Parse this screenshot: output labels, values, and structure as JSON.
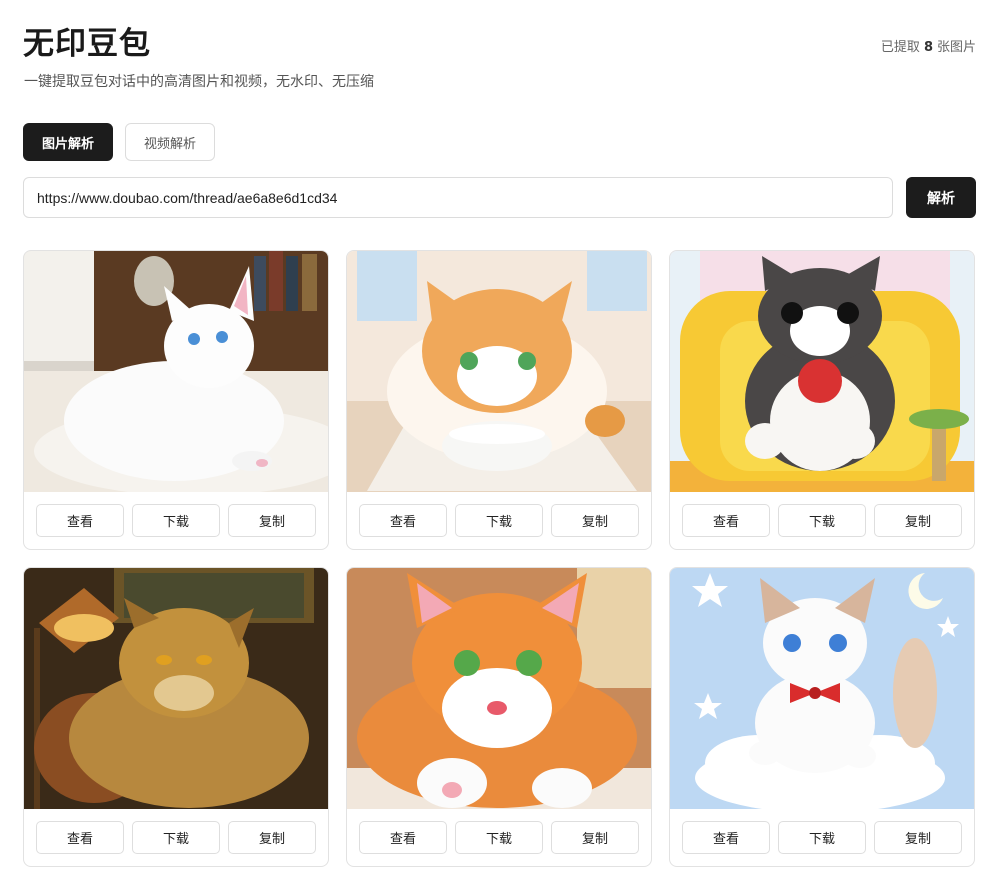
{
  "app": {
    "title": "无印豆包",
    "subtitle": "一键提取豆包对话中的高清图片和视频，无水印、无压缩",
    "count": {
      "prefix": "已提取",
      "value": "8",
      "suffix": "张图片"
    }
  },
  "tabs": [
    {
      "label": "图片解析",
      "active": true
    },
    {
      "label": "视频解析",
      "active": false
    }
  ],
  "search": {
    "value": "https://www.doubao.com/thread/ae6a8e6d1cd34",
    "button_label": "解析"
  },
  "cards": [
    {
      "image": "white-longhair-cat-on-rug",
      "actions": [
        "查看",
        "下载",
        "复制"
      ]
    },
    {
      "image": "orange-cat-with-milk-bowl",
      "actions": [
        "查看",
        "下载",
        "复制"
      ]
    },
    {
      "image": "tabby-cat-with-yarn-on-yellow-sofa",
      "actions": [
        "查看",
        "下载",
        "复制"
      ]
    },
    {
      "image": "tabby-cat-by-lamp",
      "actions": [
        "查看",
        "下载",
        "复制"
      ]
    },
    {
      "image": "orange-fluffy-cat-paw",
      "actions": [
        "查看",
        "下载",
        "复制"
      ]
    },
    {
      "image": "white-kitten-on-cloud",
      "actions": [
        "查看",
        "下载",
        "复制"
      ]
    }
  ],
  "colors": {
    "primary": "#1c1c1c",
    "border": "#dcdcdc",
    "text_muted": "#555555"
  }
}
